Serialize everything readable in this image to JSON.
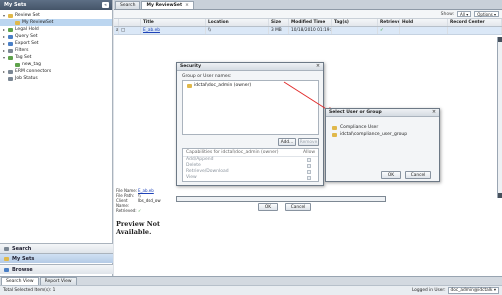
{
  "left_panel": {
    "title": "My Sets",
    "collapse_glyph": "«",
    "tree": [
      {
        "label": "Review Set",
        "toggle": "▾",
        "icon": "folder",
        "level": 0
      },
      {
        "label": "My ReviewSet",
        "toggle": "",
        "icon": "folder",
        "level": 1,
        "selected": true
      },
      {
        "label": "Legal Hold",
        "toggle": "▸",
        "icon": "green",
        "level": 0
      },
      {
        "label": "Query Set",
        "toggle": "▸",
        "icon": "blue",
        "level": 0
      },
      {
        "label": "Export Set",
        "toggle": "▸",
        "icon": "blue",
        "level": 0
      },
      {
        "label": "Filters",
        "toggle": "▸",
        "icon": "gray",
        "level": 0
      },
      {
        "label": "Tag Set",
        "toggle": "▾",
        "icon": "green",
        "level": 0
      },
      {
        "label": "new_tag",
        "toggle": "",
        "icon": "green",
        "level": 1
      },
      {
        "label": "ERM connectors",
        "toggle": "▸",
        "icon": "gray",
        "level": 0
      },
      {
        "label": "Job Status",
        "toggle": "",
        "icon": "gray",
        "level": 0
      }
    ],
    "nav": {
      "search": "Search",
      "my_sets": "My Sets",
      "browse": "Browse"
    }
  },
  "tabs": [
    {
      "label": "Search",
      "active": false
    },
    {
      "label": "My ReviewSet",
      "active": true,
      "close": "×"
    }
  ],
  "toolbar": {
    "show_label": "Show:",
    "show_value": "All",
    "options_label": "Options"
  },
  "grid": {
    "columns": [
      "",
      "",
      "Title",
      "Location",
      "Size",
      "Modified Time",
      "Tag(s)",
      "Retrieved",
      "Hold",
      "Record Center"
    ],
    "rows": [
      {
        "num": "a1",
        "title": "E_ab.eb",
        "location": "\\\\",
        "size": "3 MB",
        "modified": "10/18/2010 01:19:43 ...",
        "tags": "",
        "retrieved": "✓",
        "hold": "",
        "record": ""
      }
    ]
  },
  "preview": {
    "fields": [
      {
        "k": "File Name:",
        "v": "E_ab.eb",
        "link": true
      },
      {
        "k": "File Path:",
        "v": "\\\\",
        "link": false
      },
      {
        "k": "Client Name:",
        "v": "lbs_dsd_ow",
        "link": false
      },
      {
        "k": "Retrieved:",
        "v": "✓",
        "link": false
      }
    ],
    "not_available": "Preview Not Available."
  },
  "security_dialog": {
    "title": "Security",
    "close": "×",
    "group_label": "Group or User names:",
    "members": [
      "idctal\\doc_admin (owner)"
    ],
    "add_label": "Add...",
    "remove_label": "Remove",
    "cap_header": "Capabilities for idctal\\doc_admin (owner)",
    "allow_header": "Allow",
    "capabilities": [
      "Add/Append",
      "Delete",
      "Retrieve/Download",
      "View"
    ],
    "ok_label": "OK",
    "cancel_label": "Cancel"
  },
  "select_dialog": {
    "title": "Select User or Group",
    "close": "×",
    "items": [
      "Compliance User",
      "idctal\\compliance_user_group"
    ],
    "ok_label": "OK",
    "cancel_label": "Cancel"
  },
  "status": {
    "tabs": [
      "Search View",
      "Report View"
    ],
    "left_text": "Total Selected Item(s): 1",
    "logged_label": "Logged in User:",
    "user": "doc_admin@idctalk"
  },
  "colors": {
    "arrow": "#e22b2b",
    "accent": "#455569"
  }
}
